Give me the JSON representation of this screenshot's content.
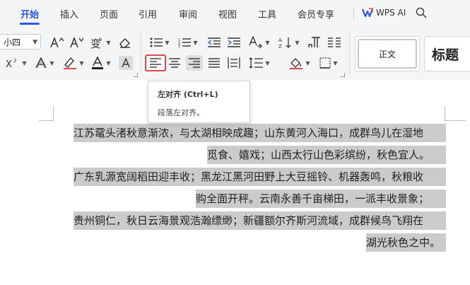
{
  "tabs": [
    {
      "label": "开始",
      "active": true
    },
    {
      "label": "插入"
    },
    {
      "label": "页面"
    },
    {
      "label": "引用"
    },
    {
      "label": "审阅"
    },
    {
      "label": "视图"
    },
    {
      "label": "工具"
    },
    {
      "label": "会员专享"
    }
  ],
  "wps_ai": {
    "label": "WPS AI",
    "icon": "wps-ai-icon"
  },
  "ribbon": {
    "font_size_value": "小四",
    "style_normal": "正文",
    "style_title": "标题"
  },
  "tooltip": {
    "title": "左对齐 (Ctrl+L)",
    "description": "段落左对齐。"
  },
  "document": {
    "lines": [
      "江苏鼋头渚秋意渐浓，与太湖相映成趣；山东黄河入海口，成群鸟儿在湿地",
      "觅食、嬉戏；山西太行山色彩缤纷，秋色宜人。",
      "广东乳源宽阔稻田迎丰收；黑龙江黑河田野上大豆摇铃、机器轰鸣，秋粮收",
      "购全面开秤。云南永善千亩梯田，一派丰收景象；",
      "贵州铜仁，秋日云海景观浩瀚缥缈；新疆额尔齐斯河流域，成群候鸟飞翔在",
      "湖光秋色之中。"
    ]
  },
  "colors": {
    "accent": "#2b56e6",
    "selection": "#cbcbcb",
    "active_align_border": "#e0474c"
  }
}
